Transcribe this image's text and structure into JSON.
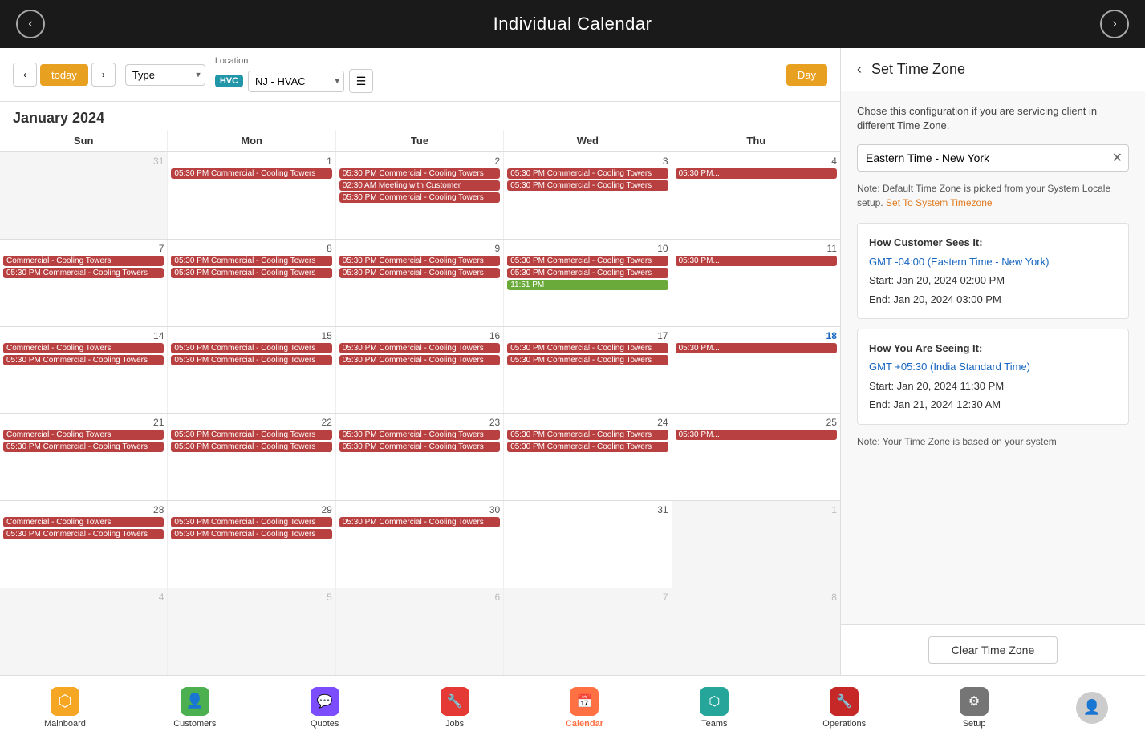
{
  "header": {
    "title": "Individual Calendar",
    "back_label": "‹",
    "forward_label": "›"
  },
  "toolbar": {
    "nav_prev": "‹",
    "nav_next": "›",
    "today_label": "today",
    "type_placeholder": "Type",
    "location_label": "Location",
    "hvc_badge": "HVC",
    "location_value": "NJ - HVAC",
    "day_label": "Day"
  },
  "calendar": {
    "month_year": "January 2024",
    "days_of_week": [
      "Sun",
      "Mon",
      "Tue",
      "Wed",
      "Thu"
    ],
    "weeks": [
      {
        "cells": [
          {
            "num": "31",
            "other": true,
            "events": []
          },
          {
            "num": "1",
            "events": [
              {
                "text": "05:30 PM Commercial - Cooling Towers",
                "type": "red"
              }
            ]
          },
          {
            "num": "2",
            "events": [
              {
                "text": "05:30 PM Commercial - Cooling Towers",
                "type": "red"
              },
              {
                "text": "02:30 AM Meeting with Customer",
                "type": "red"
              },
              {
                "text": "05:30 PM Commercial - Cooling Towers",
                "type": "red"
              }
            ]
          },
          {
            "num": "3",
            "events": [
              {
                "text": "05:30 PM Commercial - Cooling Towers",
                "type": "red"
              },
              {
                "text": "05:30 PM Commercial - Cooling Towers",
                "type": "red"
              }
            ]
          },
          {
            "num": "4",
            "events": [
              {
                "text": "05:30 PM...",
                "type": "red"
              }
            ]
          }
        ]
      },
      {
        "cells": [
          {
            "num": "7",
            "events": [
              {
                "text": "Commercial - Cooling Towers",
                "type": "red"
              },
              {
                "text": "05:30 PM Commercial - Cooling Towers",
                "type": "red"
              }
            ]
          },
          {
            "num": "8",
            "events": [
              {
                "text": "05:30 PM Commercial - Cooling Towers",
                "type": "red"
              },
              {
                "text": "05:30 PM Commercial - Cooling Towers",
                "type": "red"
              }
            ]
          },
          {
            "num": "9",
            "events": [
              {
                "text": "05:30 PM Commercial - Cooling Towers",
                "type": "red"
              },
              {
                "text": "05:30 PM Commercial - Cooling Towers",
                "type": "red"
              }
            ]
          },
          {
            "num": "10",
            "events": [
              {
                "text": "05:30 PM Commercial - Cooling Towers",
                "type": "red"
              },
              {
                "text": "05:30 PM Commercial - Cooling Towers",
                "type": "red"
              },
              {
                "text": "11:51 PM",
                "type": "green"
              }
            ]
          },
          {
            "num": "11",
            "events": [
              {
                "text": "05:30 PM...",
                "type": "red"
              }
            ]
          }
        ]
      },
      {
        "cells": [
          {
            "num": "14",
            "events": [
              {
                "text": "Commercial - Cooling Towers",
                "type": "red"
              },
              {
                "text": "05:30 PM Commercial - Cooling Towers",
                "type": "red"
              }
            ]
          },
          {
            "num": "15",
            "events": [
              {
                "text": "05:30 PM Commercial - Cooling Towers",
                "type": "red"
              },
              {
                "text": "05:30 PM Commercial - Cooling Towers",
                "type": "red"
              }
            ]
          },
          {
            "num": "16",
            "events": [
              {
                "text": "05:30 PM Commercial - Cooling Towers",
                "type": "red"
              },
              {
                "text": "05:30 PM Commercial - Cooling Towers",
                "type": "red"
              }
            ]
          },
          {
            "num": "17",
            "events": [
              {
                "text": "05:30 PM Commercial - Cooling Towers",
                "type": "red"
              },
              {
                "text": "05:30 PM Commercial - Cooling Towers",
                "type": "red"
              }
            ]
          },
          {
            "num": "18",
            "today": true,
            "events": [
              {
                "text": "05:30 PM...",
                "type": "red"
              }
            ]
          }
        ]
      },
      {
        "cells": [
          {
            "num": "21",
            "events": [
              {
                "text": "Commercial - Cooling Towers",
                "type": "red"
              },
              {
                "text": "05:30 PM Commercial - Cooling Towers",
                "type": "red"
              }
            ]
          },
          {
            "num": "22",
            "events": [
              {
                "text": "05:30 PM Commercial - Cooling Towers",
                "type": "red"
              },
              {
                "text": "05:30 PM Commercial - Cooling Towers",
                "type": "red"
              }
            ]
          },
          {
            "num": "23",
            "events": [
              {
                "text": "05:30 PM Commercial - Cooling Towers",
                "type": "red"
              },
              {
                "text": "05:30 PM Commercial - Cooling Towers",
                "type": "red"
              }
            ]
          },
          {
            "num": "24",
            "events": [
              {
                "text": "05:30 PM Commercial - Cooling Towers",
                "type": "red"
              },
              {
                "text": "05:30 PM Commercial - Cooling Towers",
                "type": "red"
              }
            ]
          },
          {
            "num": "25",
            "events": [
              {
                "text": "05:30 PM...",
                "type": "red"
              }
            ]
          }
        ]
      },
      {
        "cells": [
          {
            "num": "28",
            "events": [
              {
                "text": "Commercial - Cooling Towers",
                "type": "red"
              },
              {
                "text": "05:30 PM Commercial - Cooling Towers",
                "type": "red"
              }
            ]
          },
          {
            "num": "29",
            "events": [
              {
                "text": "05:30 PM Commercial - Cooling Towers",
                "type": "red"
              },
              {
                "text": "05:30 PM Commercial - Cooling Towers",
                "type": "red"
              }
            ]
          },
          {
            "num": "30",
            "events": [
              {
                "text": "05:30 PM Commercial - Cooling Towers",
                "type": "red"
              }
            ]
          },
          {
            "num": "31",
            "events": []
          },
          {
            "num": "1",
            "other": true,
            "events": []
          }
        ]
      },
      {
        "cells": [
          {
            "num": "4",
            "other": true,
            "events": []
          },
          {
            "num": "5",
            "other": true,
            "events": []
          },
          {
            "num": "6",
            "other": true,
            "events": []
          },
          {
            "num": "7",
            "other": true,
            "events": []
          },
          {
            "num": "8",
            "other": true,
            "events": []
          }
        ]
      }
    ]
  },
  "timezone_panel": {
    "title": "Set Time Zone",
    "description": "Chose this configuration if you are servicing client in different Time Zone.",
    "input_value": "Eastern Time - New York",
    "note_text": "Note: Default Time Zone is picked from your System Locale setup.",
    "note_link_text": "Set To System Timezone",
    "customer_section": {
      "title": "How Customer Sees It:",
      "gmt": "GMT -04:00 (Eastern Time - New York)",
      "start": "Start:  Jan 20, 2024 02:00 PM",
      "end": "End:  Jan 20, 2024 03:00 PM"
    },
    "your_section": {
      "title": "How You Are Seeing It:",
      "gmt": "GMT +05:30 (India Standard Time)",
      "start": "Start:  Jan 20, 2024 11:30 PM",
      "end": "End:  Jan 21, 2024 12:30 AM"
    },
    "bottom_note": "Note: Your Time Zone is based on your system",
    "clear_btn": "Clear Time Zone"
  },
  "bottom_nav": {
    "items": [
      {
        "label": "Mainboard",
        "icon": "⬡",
        "color": "yellow",
        "active": false
      },
      {
        "label": "Customers",
        "icon": "👤",
        "color": "green",
        "active": false
      },
      {
        "label": "Quotes",
        "icon": "💬",
        "color": "purple",
        "active": false
      },
      {
        "label": "Jobs",
        "icon": "🔧",
        "color": "red",
        "active": false
      },
      {
        "label": "Calendar",
        "icon": "📅",
        "color": "orange",
        "active": true
      },
      {
        "label": "Teams",
        "icon": "⬡",
        "color": "teal",
        "active": false
      },
      {
        "label": "Operations",
        "icon": "🔧",
        "color": "dark-red",
        "active": false
      },
      {
        "label": "Setup",
        "icon": "⚙",
        "color": "gray",
        "active": false
      }
    ]
  }
}
